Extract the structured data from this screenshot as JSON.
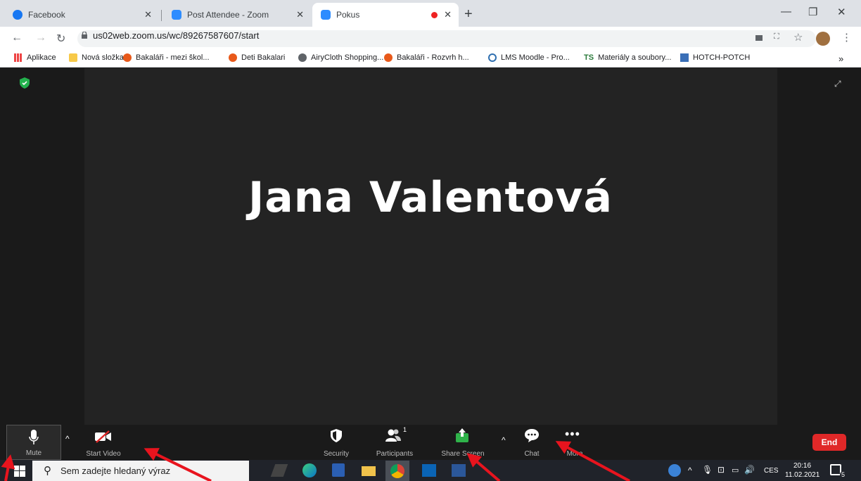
{
  "browser": {
    "tabs": [
      {
        "label": "Facebook",
        "active": false
      },
      {
        "label": "Post Attendee - Zoom",
        "active": false
      },
      {
        "label": "Pokus",
        "active": true
      }
    ],
    "url": "us02web.zoom.us/wc/89267587607/start",
    "bookmarks": [
      "Aplikace",
      "Nová složka",
      "Bakaláři - mezi škol...",
      "Deti Bakalari",
      "AiryCloth Shopping...",
      "Bakaláři - Rozvrh h...",
      "LMS Moodle - Pro...",
      "Materiály a soubory...",
      "HOTCH-POTCH"
    ],
    "bookmark_ts_label": "TS",
    "overflow": "»"
  },
  "meeting": {
    "participant_name": "Jana Valentová"
  },
  "toolbar": {
    "mute": "Mute",
    "start_video": "Start Video",
    "security": "Security",
    "participants": "Participants",
    "participants_count": "1",
    "share_screen": "Share Screen",
    "chat": "Chat",
    "more": "More",
    "end": "End"
  },
  "taskbar": {
    "search_placeholder": "Sem zadejte hledaný výraz",
    "language": "CES",
    "time": "20:16",
    "date": "11.02.2021",
    "notifications": "5"
  },
  "colors": {
    "end_red": "#e02828",
    "share_green": "#2fb34a",
    "zoom_blue": "#2d8cff",
    "arrow_red": "#e8141e"
  }
}
